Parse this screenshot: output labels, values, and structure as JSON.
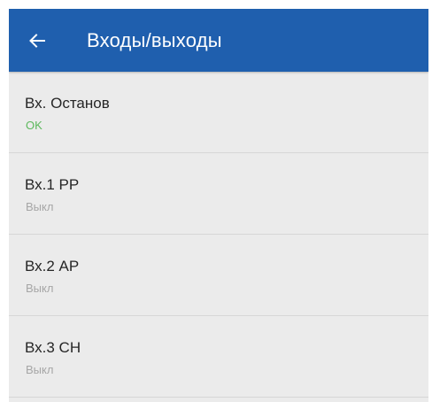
{
  "header": {
    "title": "Входы/выходы",
    "back_icon": "arrow-left-icon"
  },
  "colors": {
    "app_bar": "#1f5fae",
    "status_ok": "#5cb85c",
    "status_off": "#a6a6a6"
  },
  "inputs": [
    {
      "label": "Вх. Останов",
      "status": "OK"
    },
    {
      "label": "Вх.1 РР",
      "status": "Выкл"
    },
    {
      "label": "Вх.2 АР",
      "status": "Выкл"
    },
    {
      "label": "Вх.3 СН",
      "status": "Выкл"
    }
  ]
}
